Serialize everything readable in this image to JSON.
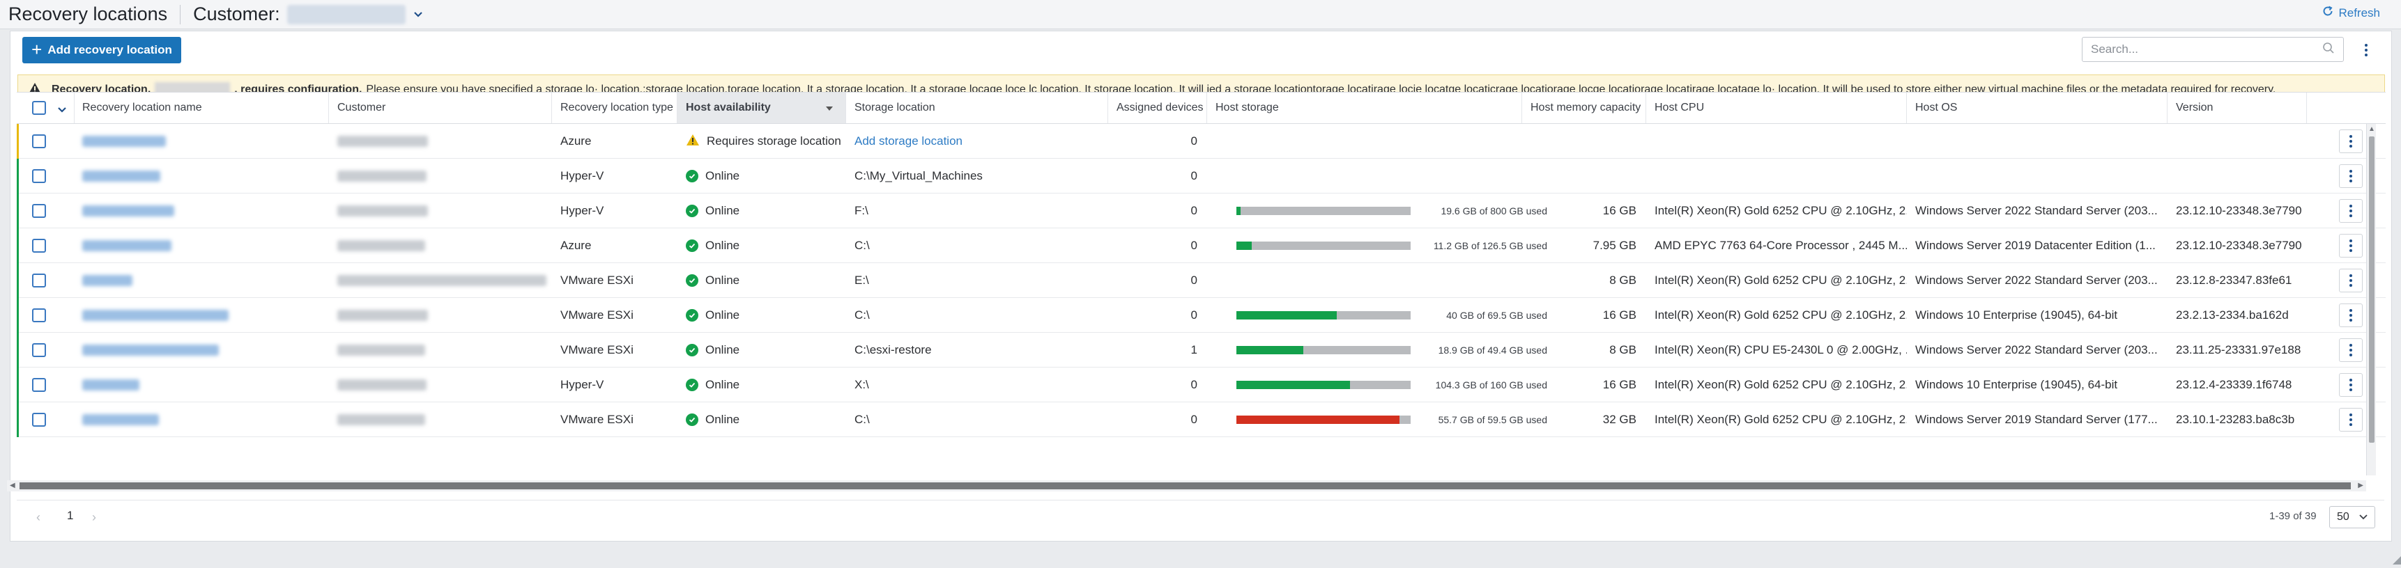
{
  "header": {
    "title": "Recovery locations",
    "customer_label": "Customer:",
    "refresh_label": "Refresh"
  },
  "toolbar": {
    "add_label": "Add recovery location",
    "search_placeholder": "Search..."
  },
  "banner": {
    "prefix": "Recovery location,",
    "suffix": ", requires configuration.",
    "message": "Please ensure you have specified a storage lo· location.:storage location.torage location. It a storage location. It  a storage locage loce lc location. It storage location. It will ied a storage locationtorage locatirage locje locatge locaticrage locatiorage locge locatiorage locatirage locatage lo· location. It will be used to store either new virtual machine files or the metadata required for recovery."
  },
  "table": {
    "columns": [
      "Recovery location name",
      "Customer",
      "Recovery location type",
      "Host availability",
      "Storage location",
      "Assigned devices",
      "Host storage",
      "Host memory capacity",
      "Host CPU",
      "Host OS",
      "Version"
    ],
    "rows": [
      {
        "type": "Azure",
        "status": "Requires storage location",
        "status_kind": "warning",
        "storage_location": "Add storage location",
        "storage_is_link": true,
        "devices": "0",
        "storage_text": "",
        "storage_pct": null,
        "storage_color": "",
        "memory": "",
        "cpu": "",
        "os": "",
        "version": "",
        "accent": "#e8b90f"
      },
      {
        "type": "Hyper-V",
        "status": "Online",
        "status_kind": "ok",
        "storage_location": "C:\\My_Virtual_Machines",
        "storage_is_link": false,
        "devices": "0",
        "storage_text": "",
        "storage_pct": null,
        "storage_color": "",
        "memory": "",
        "cpu": "",
        "os": "",
        "version": "",
        "accent": "#13a04b"
      },
      {
        "type": "Hyper-V",
        "status": "Online",
        "status_kind": "ok",
        "storage_location": "F:\\",
        "storage_is_link": false,
        "devices": "0",
        "storage_text": "19.6 GB of 800 GB used",
        "storage_pct": 0.025,
        "storage_color": "#13a04b",
        "memory": "16 GB",
        "cpu": "Intel(R) Xeon(R) Gold 6252 CPU @ 2.10GHz, 2...",
        "os": "Windows Server 2022 Standard Server (203...",
        "version": "23.12.10-23348.3e7790",
        "accent": "#13a04b"
      },
      {
        "type": "Azure",
        "status": "Online",
        "status_kind": "ok",
        "storage_location": "C:\\",
        "storage_is_link": false,
        "devices": "0",
        "storage_text": "11.2 GB of 126.5 GB used",
        "storage_pct": 0.089,
        "storage_color": "#13a04b",
        "memory": "7.95 GB",
        "cpu": "AMD EPYC 7763 64-Core Processor , 2445 M...",
        "os": "Windows Server 2019 Datacenter Edition (1...",
        "version": "23.12.10-23348.3e7790",
        "accent": "#13a04b"
      },
      {
        "type": "VMware ESXi",
        "status": "Online",
        "status_kind": "ok",
        "storage_location": "E:\\",
        "storage_is_link": false,
        "devices": "0",
        "storage_text": "",
        "storage_pct": null,
        "storage_color": "",
        "memory": "8 GB",
        "cpu": "Intel(R) Xeon(R) Gold 6252 CPU @ 2.10GHz, 2...",
        "os": "Windows Server 2022 Standard Server (203...",
        "version": "23.12.8-23347.83fe61",
        "accent": "#13a04b"
      },
      {
        "type": "VMware ESXi",
        "status": "Online",
        "status_kind": "ok",
        "storage_location": "C:\\",
        "storage_is_link": false,
        "devices": "0",
        "storage_text": "40 GB of 69.5 GB used",
        "storage_pct": 0.576,
        "storage_color": "#13a04b",
        "memory": "16 GB",
        "cpu": "Intel(R) Xeon(R) Gold 6252 CPU @ 2.10GHz, 2...",
        "os": "Windows 10 Enterprise (19045), 64-bit",
        "version": "23.2.13-2334.ba162d",
        "accent": "#13a04b"
      },
      {
        "type": "VMware ESXi",
        "status": "Online",
        "status_kind": "ok",
        "storage_location": "C:\\esxi-restore",
        "storage_is_link": false,
        "devices": "1",
        "storage_text": "18.9 GB of 49.4 GB used",
        "storage_pct": 0.383,
        "storage_color": "#13a04b",
        "memory": "8 GB",
        "cpu": "Intel(R) Xeon(R) CPU E5-2430L 0 @ 2.00GHz, ...",
        "os": "Windows Server 2022 Standard Server (203...",
        "version": "23.11.25-23331.97e188",
        "accent": "#13a04b"
      },
      {
        "type": "Hyper-V",
        "status": "Online",
        "status_kind": "ok",
        "storage_location": "X:\\",
        "storage_is_link": false,
        "devices": "0",
        "storage_text": "104.3 GB of 160 GB used",
        "storage_pct": 0.652,
        "storage_color": "#13a04b",
        "memory": "16 GB",
        "cpu": "Intel(R) Xeon(R) Gold 6252 CPU @ 2.10GHz, 2...",
        "os": "Windows 10 Enterprise (19045), 64-bit",
        "version": "23.12.4-23339.1f6748",
        "accent": "#13a04b"
      },
      {
        "type": "VMware ESXi",
        "status": "Online",
        "status_kind": "ok",
        "storage_location": "C:\\",
        "storage_is_link": false,
        "devices": "0",
        "storage_text": "55.7 GB of 59.5 GB used",
        "storage_pct": 0.936,
        "storage_color": "#d3301f",
        "memory": "32 GB",
        "cpu": "Intel(R) Xeon(R) Gold 6252 CPU @ 2.10GHz, 2...",
        "os": "Windows Server 2019 Standard Server (177...",
        "version": "23.10.1-23283.ba8c3b",
        "accent": "#13a04b"
      }
    ]
  },
  "pagination": {
    "current_page": "1",
    "range": "1-39 of 39",
    "page_size": "50"
  },
  "colors": {
    "primary": "#1a73b8",
    "online": "#13a04b",
    "warning": "#e8b90f",
    "critical": "#d3301f"
  }
}
